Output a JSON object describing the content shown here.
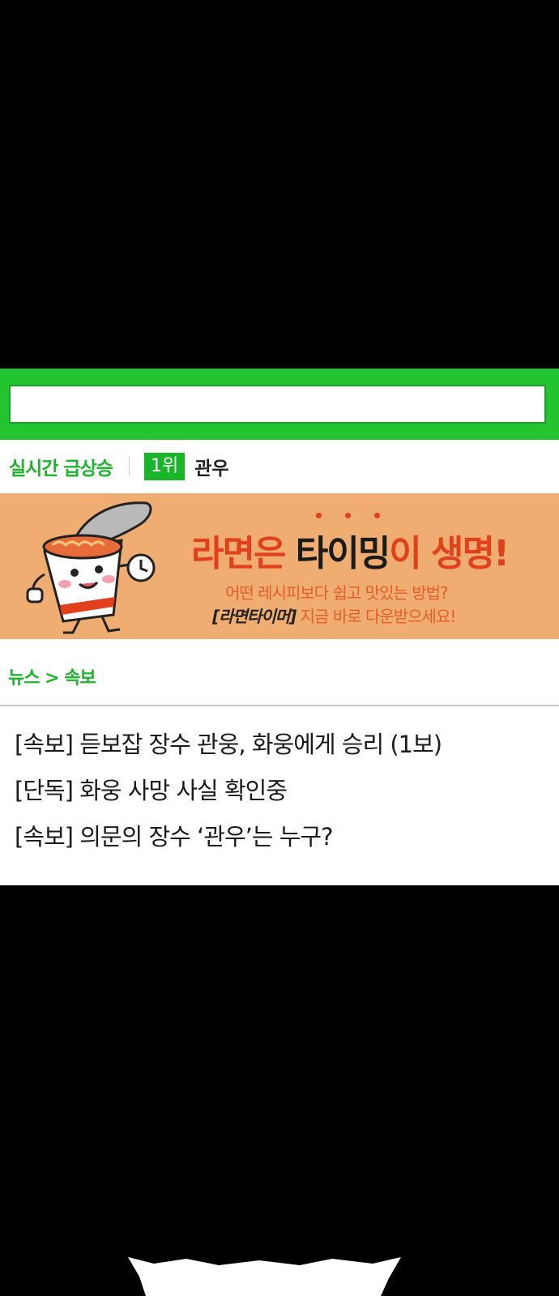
{
  "search": {
    "value": "",
    "placeholder": ""
  },
  "trending": {
    "label": "실시간 급상승",
    "rank": "1위",
    "term": "관우"
  },
  "ad": {
    "headline_prefix": "라면은 ",
    "headline_emphasis": "타이밍",
    "headline_suffix": "이 생명!",
    "subline1": "어떤 레시피보다 쉽고 맛있는 방법?",
    "app_name": "[라면타이머]",
    "subline2_rest": " 지금 바로 다운받으세요!",
    "mascot_icon": "ramen-cup-mascot-icon",
    "colors": {
      "background": "#f0ad72",
      "accent": "#e0401c",
      "subtext": "#e55d2b"
    }
  },
  "news": {
    "breadcrumb": "뉴스 > 속보",
    "items": [
      "[속보] 듣보잡 장수 관웅, 화웅에게 승리 (1보)",
      "[단독] 화웅 사망 사실 확인중",
      "[속보] 의문의 장수 ‘관우’는 누구?"
    ]
  },
  "colors": {
    "brand_green": "#22c530",
    "label_green": "#1bb52a"
  }
}
